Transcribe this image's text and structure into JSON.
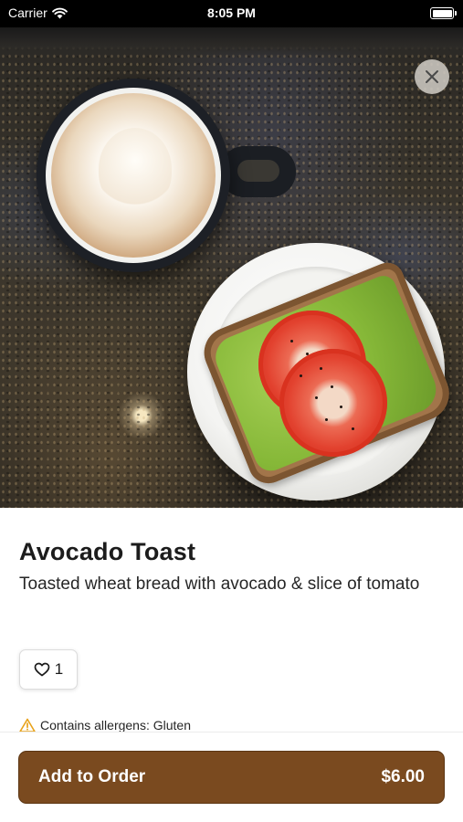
{
  "status_bar": {
    "carrier": "Carrier",
    "time": "8:05 PM"
  },
  "item": {
    "name": "Avocado Toast",
    "description": "Toasted wheat bread with avocado & slice of tomato",
    "like_count": "1",
    "allergen_text": "Contains allergens: Gluten"
  },
  "order_button": {
    "label": "Add to Order",
    "price": "$6.00"
  },
  "icons": [
    "wifi-icon",
    "battery-icon",
    "close-icon",
    "heart-icon",
    "warning-icon"
  ],
  "colors": {
    "accent": "#7a4a1f",
    "warning": "#e8a21a"
  }
}
